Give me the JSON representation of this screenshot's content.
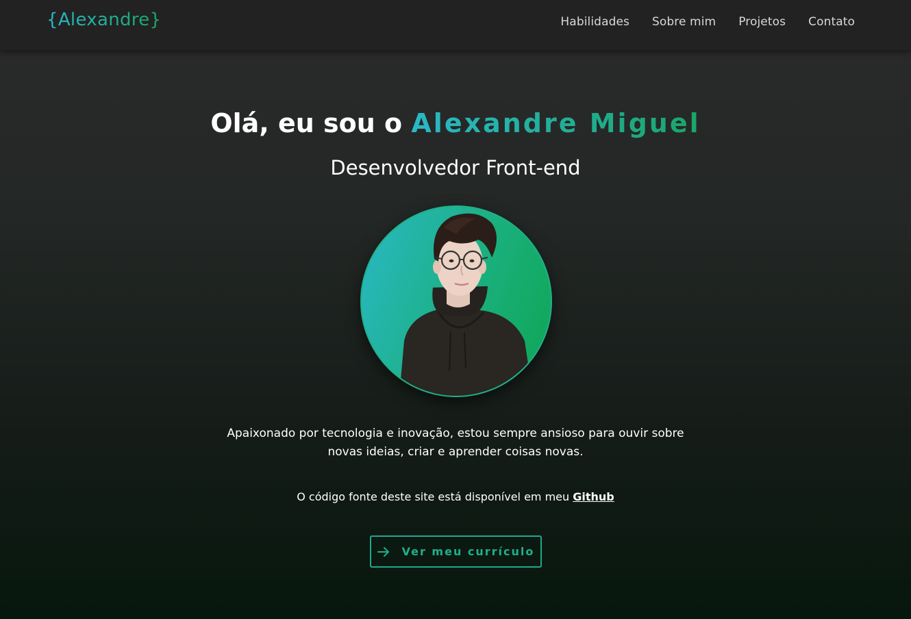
{
  "navbar": {
    "logo": "{Alexandre}",
    "links": [
      {
        "label": "Habilidades"
      },
      {
        "label": "Sobre mim"
      },
      {
        "label": "Projetos"
      },
      {
        "label": "Contato"
      }
    ]
  },
  "hero": {
    "greeting": "Olá, eu sou o ",
    "name": "Alexandre Miguel",
    "subtitle": "Desenvolvedor Front-end",
    "avatar_icon": "profile-photo",
    "description": "Apaixonado por tecnologia e inovação, estou sempre ansioso para ouvir sobre novas ideias, criar e aprender coisas novas.",
    "source_note": "O código fonte deste site está disponível em meu ",
    "github_label": "Github",
    "cv_button_label": "Ver meu currículo",
    "cv_button_icon": "arrow-right-icon"
  },
  "colors": {
    "accent_start": "#2bb8c6",
    "accent_end": "#1aa56a",
    "navbar_bg": "#222222",
    "text": "#ffffff"
  }
}
